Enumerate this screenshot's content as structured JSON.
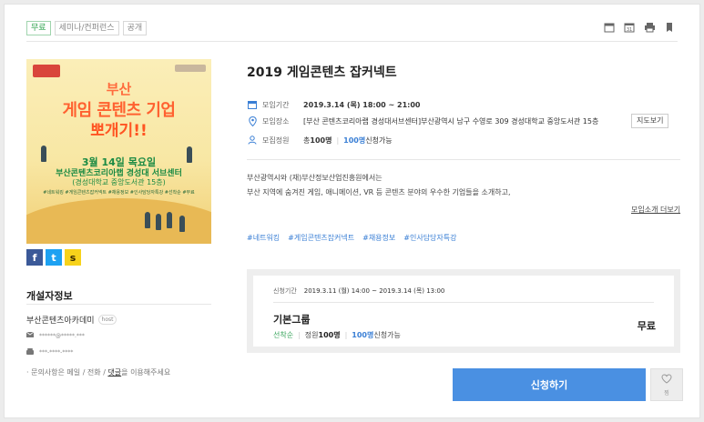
{
  "tags": {
    "free": "무료",
    "category": "세미나/컨퍼런스",
    "visibility": "공개"
  },
  "top_icons": [
    "calendar-icon",
    "calendar-31-icon",
    "print-icon",
    "bookmark-icon"
  ],
  "poster": {
    "logo_left": "",
    "title_line1": "부산",
    "title_line2": "게임 콘텐츠 기업",
    "title_line3": "뽀개기!!",
    "date": "3월 14일 목요일",
    "venue": "부산콘텐츠코리아랩 경성대 서브센터",
    "venue_detail": "(경성대학교 중앙도서관 15층)",
    "tags": "#네트워킹 #게임콘텐츠잡커넥트 #채용정보 #인사담당자특강 #선착순 #무료"
  },
  "social": {
    "facebook": "f",
    "twitter": "t",
    "kakaostory": "s"
  },
  "host": {
    "section_title": "개설자정보",
    "name": "부산콘텐츠아카데미",
    "badge": "host",
    "email": "******@*****.***",
    "phone": "***-****-****",
    "note_prefix": "· 문의사항은 메일 / 전화 / ",
    "note_link": "댓글",
    "note_suffix": "을 이용해주세요"
  },
  "event": {
    "title": "2019 게임콘텐츠 잡커넥트",
    "date_label": "모임기간",
    "date_value": "2019.3.14 (목) 18:00 ~ 21:00",
    "place_label": "모임장소",
    "place_value": "[부산 콘텐츠코리아랩 경성대서브센터]부산광역시 남구 수영로 309 경성대학교 중앙도서관 15층",
    "map_button": "지도보기",
    "capacity_label": "모집정원",
    "capacity_total_prefix": "총 ",
    "capacity_total": "100명",
    "capacity_remaining": "100명",
    "capacity_remaining_suffix": " 신청가능"
  },
  "description": {
    "line1": "부산광역시와 (재)부산정보산업진흥원에서는",
    "line2": "부산 지역에 숨겨진 게임, 애니메이션, VR 등 콘텐츠 분야의 우수한 기업들을 소개하고,",
    "more_link": "모임소개 더보기"
  },
  "hashtags": [
    "#네트워킹",
    "#게임콘텐츠잡커넥트",
    "#채용정보",
    "#인사담당자특강"
  ],
  "ticket": {
    "period_label": "신청기간",
    "period_value": "2019.3.11 (월) 14:00 ~ 2019.3.14 (목) 13:00",
    "group_name": "기본그룹",
    "price": "무료",
    "method": "선착순",
    "capacity_prefix": "정원 ",
    "capacity": "100명",
    "remaining": "100명",
    "remaining_suffix": " 신청가능"
  },
  "actions": {
    "apply": "신청하기",
    "like": "찜"
  },
  "colors": {
    "accent": "#4a90e2",
    "green": "#2ba14b",
    "poster_orange": "#ff6130"
  }
}
